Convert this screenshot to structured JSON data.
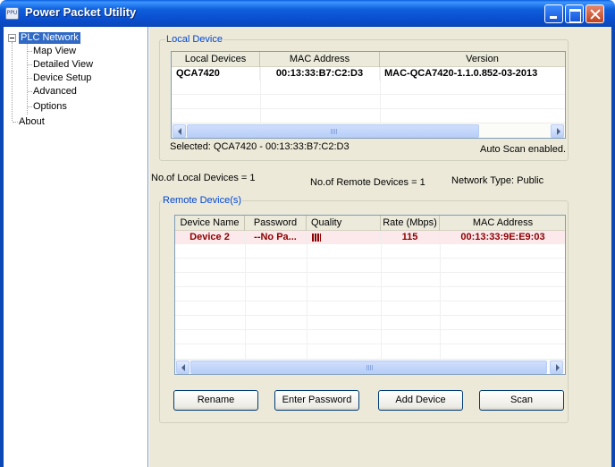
{
  "window": {
    "title": "Power Packet Utility",
    "icon": "app-icon",
    "icon_label": "PPU",
    "title_bar_color": "#0b4fd0"
  },
  "tree": {
    "root": "PLC Network",
    "children": [
      "Map View",
      "Detailed View",
      "Device Setup",
      "Advanced",
      "Options"
    ],
    "about": "About"
  },
  "local_device": {
    "legend": "Local Device",
    "columns": [
      "Local Devices",
      "MAC Address",
      "Version"
    ],
    "rows": [
      {
        "device": "QCA7420",
        "mac": "00:13:33:B7:C2:D3",
        "version": "MAC-QCA7420-1.1.0.852-03-2013"
      }
    ],
    "selected_text": "Selected: QCA7420 - 00:13:33:B7:C2:D3",
    "auto_scan_text": "Auto Scan enabled."
  },
  "summary": {
    "local_count": "No.of Local Devices = 1",
    "remote_count": "No.of Remote Devices = 1",
    "network_type": "Network Type: Public"
  },
  "remote_devices": {
    "legend": "Remote Device(s)",
    "columns": [
      "Device Name",
      "Password",
      "Quality",
      "Rate (Mbps)",
      "MAC Address"
    ],
    "rows": [
      {
        "name": "Device 2",
        "password": "--No Pa...",
        "quality_bars": 4,
        "rate": "115",
        "mac": "00:13:33:9E:E9:03"
      }
    ],
    "row_color": "#8b0000",
    "row_bg": "#fbe9ec"
  },
  "buttons": {
    "rename": "Rename",
    "enter_password": "Enter Password",
    "add_device": "Add Device",
    "scan": "Scan"
  },
  "colors": {
    "selection": "#316ac5",
    "legend_text": "#0046d5",
    "panel_bg": "#ece9d8"
  }
}
